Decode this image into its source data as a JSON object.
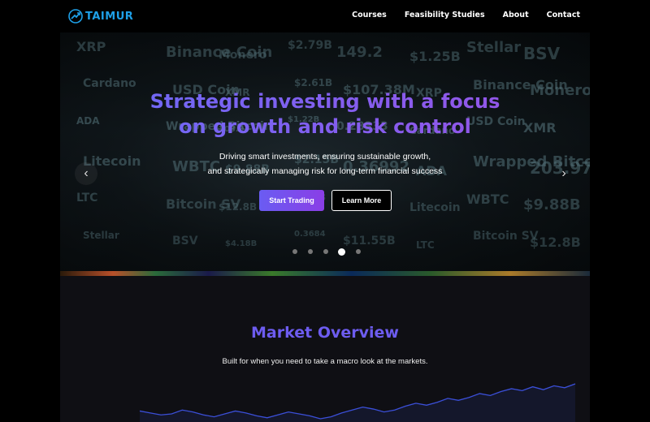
{
  "nav": {
    "brand": "TAIMUR",
    "links": [
      "Courses",
      "Feasibility Studies",
      "About",
      "Contact"
    ]
  },
  "hero": {
    "title_line1": "Strategic investing with a focus",
    "title_line2": "on growth and risk control",
    "sub_line1": "Driving smart investments, ensuring sustainable growth,",
    "sub_line2": "and strategically managing risk for long-term financial success",
    "primary_button": "Start Trading",
    "secondary_button": "Learn More",
    "carousel": {
      "slides": 5,
      "active_index": 3
    },
    "background_ticker": [
      "XRP",
      "Cardano",
      "ADA",
      "Litecoin",
      "LTC",
      "Stellar",
      "Binance Coin",
      "USD Coin",
      "Wrapped Bitcoin",
      "WBTC",
      "Bitcoin SV",
      "BSV",
      "Monero",
      "XMR",
      "203.97",
      "$9.88B",
      "$12.8B",
      "$4.18B",
      "$2.79B",
      "$2.61B",
      "$1.22B",
      "$2.15B",
      "$3.80B",
      "0.3684",
      "149.2",
      "$107.38M",
      "0.28333",
      "0.36992",
      "149.07",
      "$11.55B",
      "$1.25B"
    ],
    "accent_colors": {
      "primary_button": "#7a4cec",
      "title_gradient": [
        "#6a6cf8",
        "#9a52e6"
      ]
    }
  },
  "market": {
    "title": "Market Overview",
    "subtitle": "Built for when you need to take a macro look at the markets.",
    "chart_data": {
      "type": "line",
      "values": [
        22,
        20,
        18,
        19,
        23,
        21,
        18,
        16,
        19,
        22,
        20,
        17,
        15,
        18,
        21,
        19,
        17,
        14,
        16,
        20,
        23,
        26,
        24,
        21,
        23,
        27,
        30,
        28,
        31,
        35,
        33,
        36,
        40,
        38,
        42,
        45,
        43,
        47,
        44,
        48,
        46,
        50
      ],
      "line_color": "#3b4fd8"
    }
  }
}
